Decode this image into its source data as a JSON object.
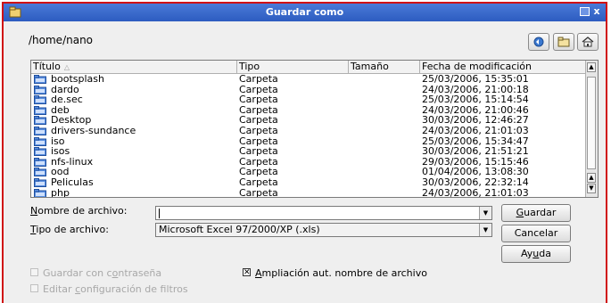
{
  "window": {
    "title": "Guardar como",
    "icon": "folder-app-icon",
    "close_glyph": "x"
  },
  "location": {
    "path": "/home/nano"
  },
  "toolbar": {
    "buttons": [
      "back-refresh-icon",
      "folder-icon",
      "home-icon"
    ]
  },
  "file_list": {
    "columns": [
      "Título",
      "Tipo",
      "Tamaño",
      "Fecha de modificación"
    ],
    "rows": [
      {
        "name": "bootsplash",
        "type": "Carpeta",
        "date": "25/03/2006, 15:35:01"
      },
      {
        "name": "dardo",
        "type": "Carpeta",
        "date": "24/03/2006, 21:00:18"
      },
      {
        "name": "de.sec",
        "type": "Carpeta",
        "date": "25/03/2006, 15:14:54"
      },
      {
        "name": "deb",
        "type": "Carpeta",
        "date": "24/03/2006, 21:00:46"
      },
      {
        "name": "Desktop",
        "type": "Carpeta",
        "date": "30/03/2006, 12:46:27"
      },
      {
        "name": "drivers-sundance",
        "type": "Carpeta",
        "date": "24/03/2006, 21:01:03"
      },
      {
        "name": "iso",
        "type": "Carpeta",
        "date": "25/03/2006, 15:34:47"
      },
      {
        "name": "isos",
        "type": "Carpeta",
        "date": "30/03/2006, 21:51:21"
      },
      {
        "name": "nfs-linux",
        "type": "Carpeta",
        "date": "29/03/2006, 15:15:46"
      },
      {
        "name": "ood",
        "type": "Carpeta",
        "date": "01/04/2006, 13:08:30"
      },
      {
        "name": "Peliculas",
        "type": "Carpeta",
        "date": "30/03/2006, 22:32:14"
      },
      {
        "name": "php",
        "type": "Carpeta",
        "date": "24/03/2006, 21:01:03"
      }
    ]
  },
  "form": {
    "filename_label_u": "N",
    "filename_label_rest": "ombre de archivo:",
    "filename_value": "",
    "filetype_label_u": "T",
    "filetype_label_rest": "ipo de archivo:",
    "filetype_value": "Microsoft Excel 97/2000/XP (.xls)"
  },
  "buttons": {
    "save_u": "G",
    "save_rest": "uardar",
    "cancel": "Cancelar",
    "help_pre": "Ay",
    "help_u": "u",
    "help_post": "da"
  },
  "options": {
    "password_pre": "Guardar con c",
    "password_u": "o",
    "password_post": "ntraseña",
    "password_checked": false,
    "autoext_u": "A",
    "autoext_rest": "mpliación aut. nombre de archivo",
    "autoext_checked": true,
    "filters_pre": "Editar ",
    "filters_u": "c",
    "filters_post": "onfiguración de filtros",
    "filters_checked": false
  },
  "colors": {
    "titlebar": "#3a6ad0",
    "frame_border": "#d01010",
    "dialog_bg": "#efefef"
  }
}
